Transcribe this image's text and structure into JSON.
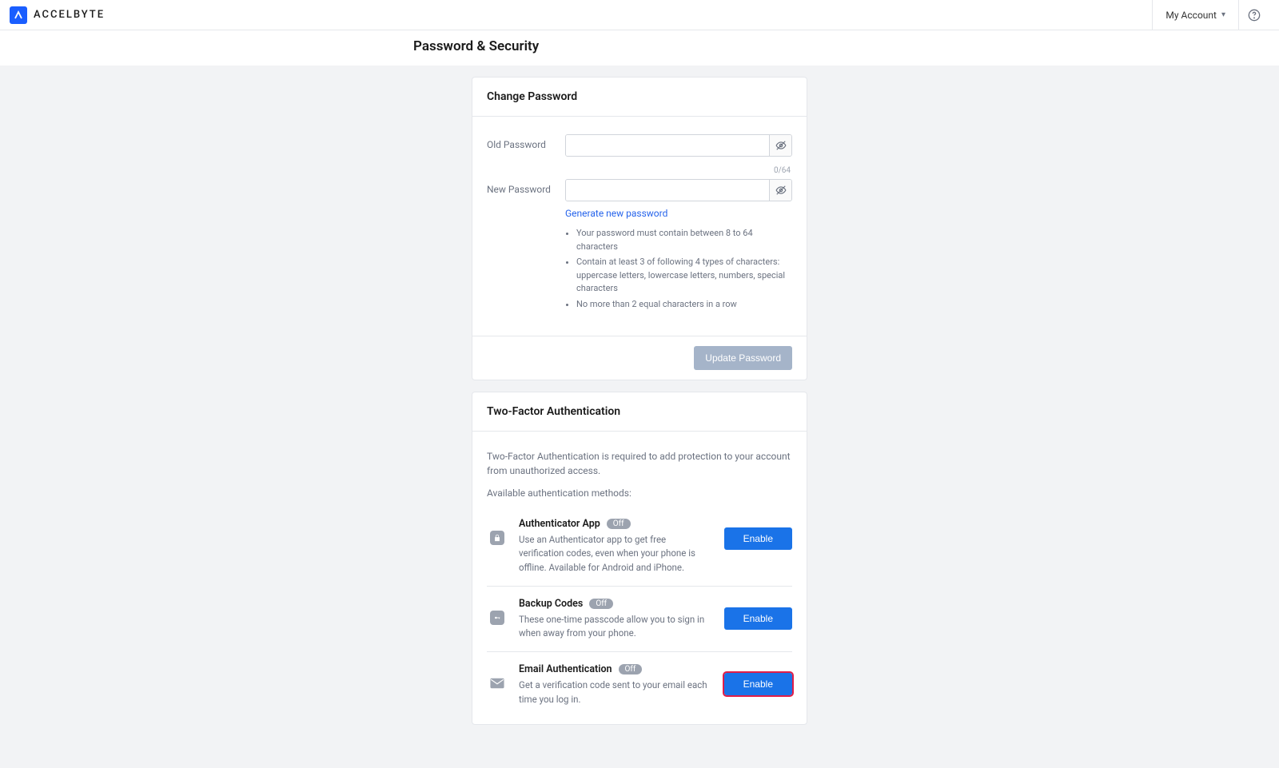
{
  "header": {
    "brand_text": "ACCELBYTE",
    "account_label": "My Account"
  },
  "page": {
    "title": "Password & Security"
  },
  "change_password": {
    "card_title": "Change Password",
    "old_label": "Old Password",
    "new_label": "New Password",
    "old_value": "",
    "new_value": "",
    "counter": "0/64",
    "generate_link": "Generate new password",
    "hints": [
      "Your password must contain between 8 to 64 characters",
      "Contain at least 3 of following 4 types of characters: uppercase letters, lowercase letters, numbers, special characters",
      "No more than 2 equal characters in a row"
    ],
    "submit_label": "Update Password"
  },
  "tfa": {
    "card_title": "Two-Factor Authentication",
    "description": "Two-Factor Authentication is required to add protection to your account from unauthorized access.",
    "subtitle": "Available authentication methods:",
    "items": [
      {
        "name": "Authenticator App",
        "badge": "Off",
        "text": "Use an Authenticator app to get free verification codes, even when your phone is offline. Available for Android and iPhone.",
        "action": "Enable"
      },
      {
        "name": "Backup Codes",
        "badge": "Off",
        "text": "These one-time passcode allow you to sign in when away from your phone.",
        "action": "Enable"
      },
      {
        "name": "Email Authentication",
        "badge": "Off",
        "text": "Get a verification code sent to your email each time you log in.",
        "action": "Enable"
      }
    ]
  }
}
